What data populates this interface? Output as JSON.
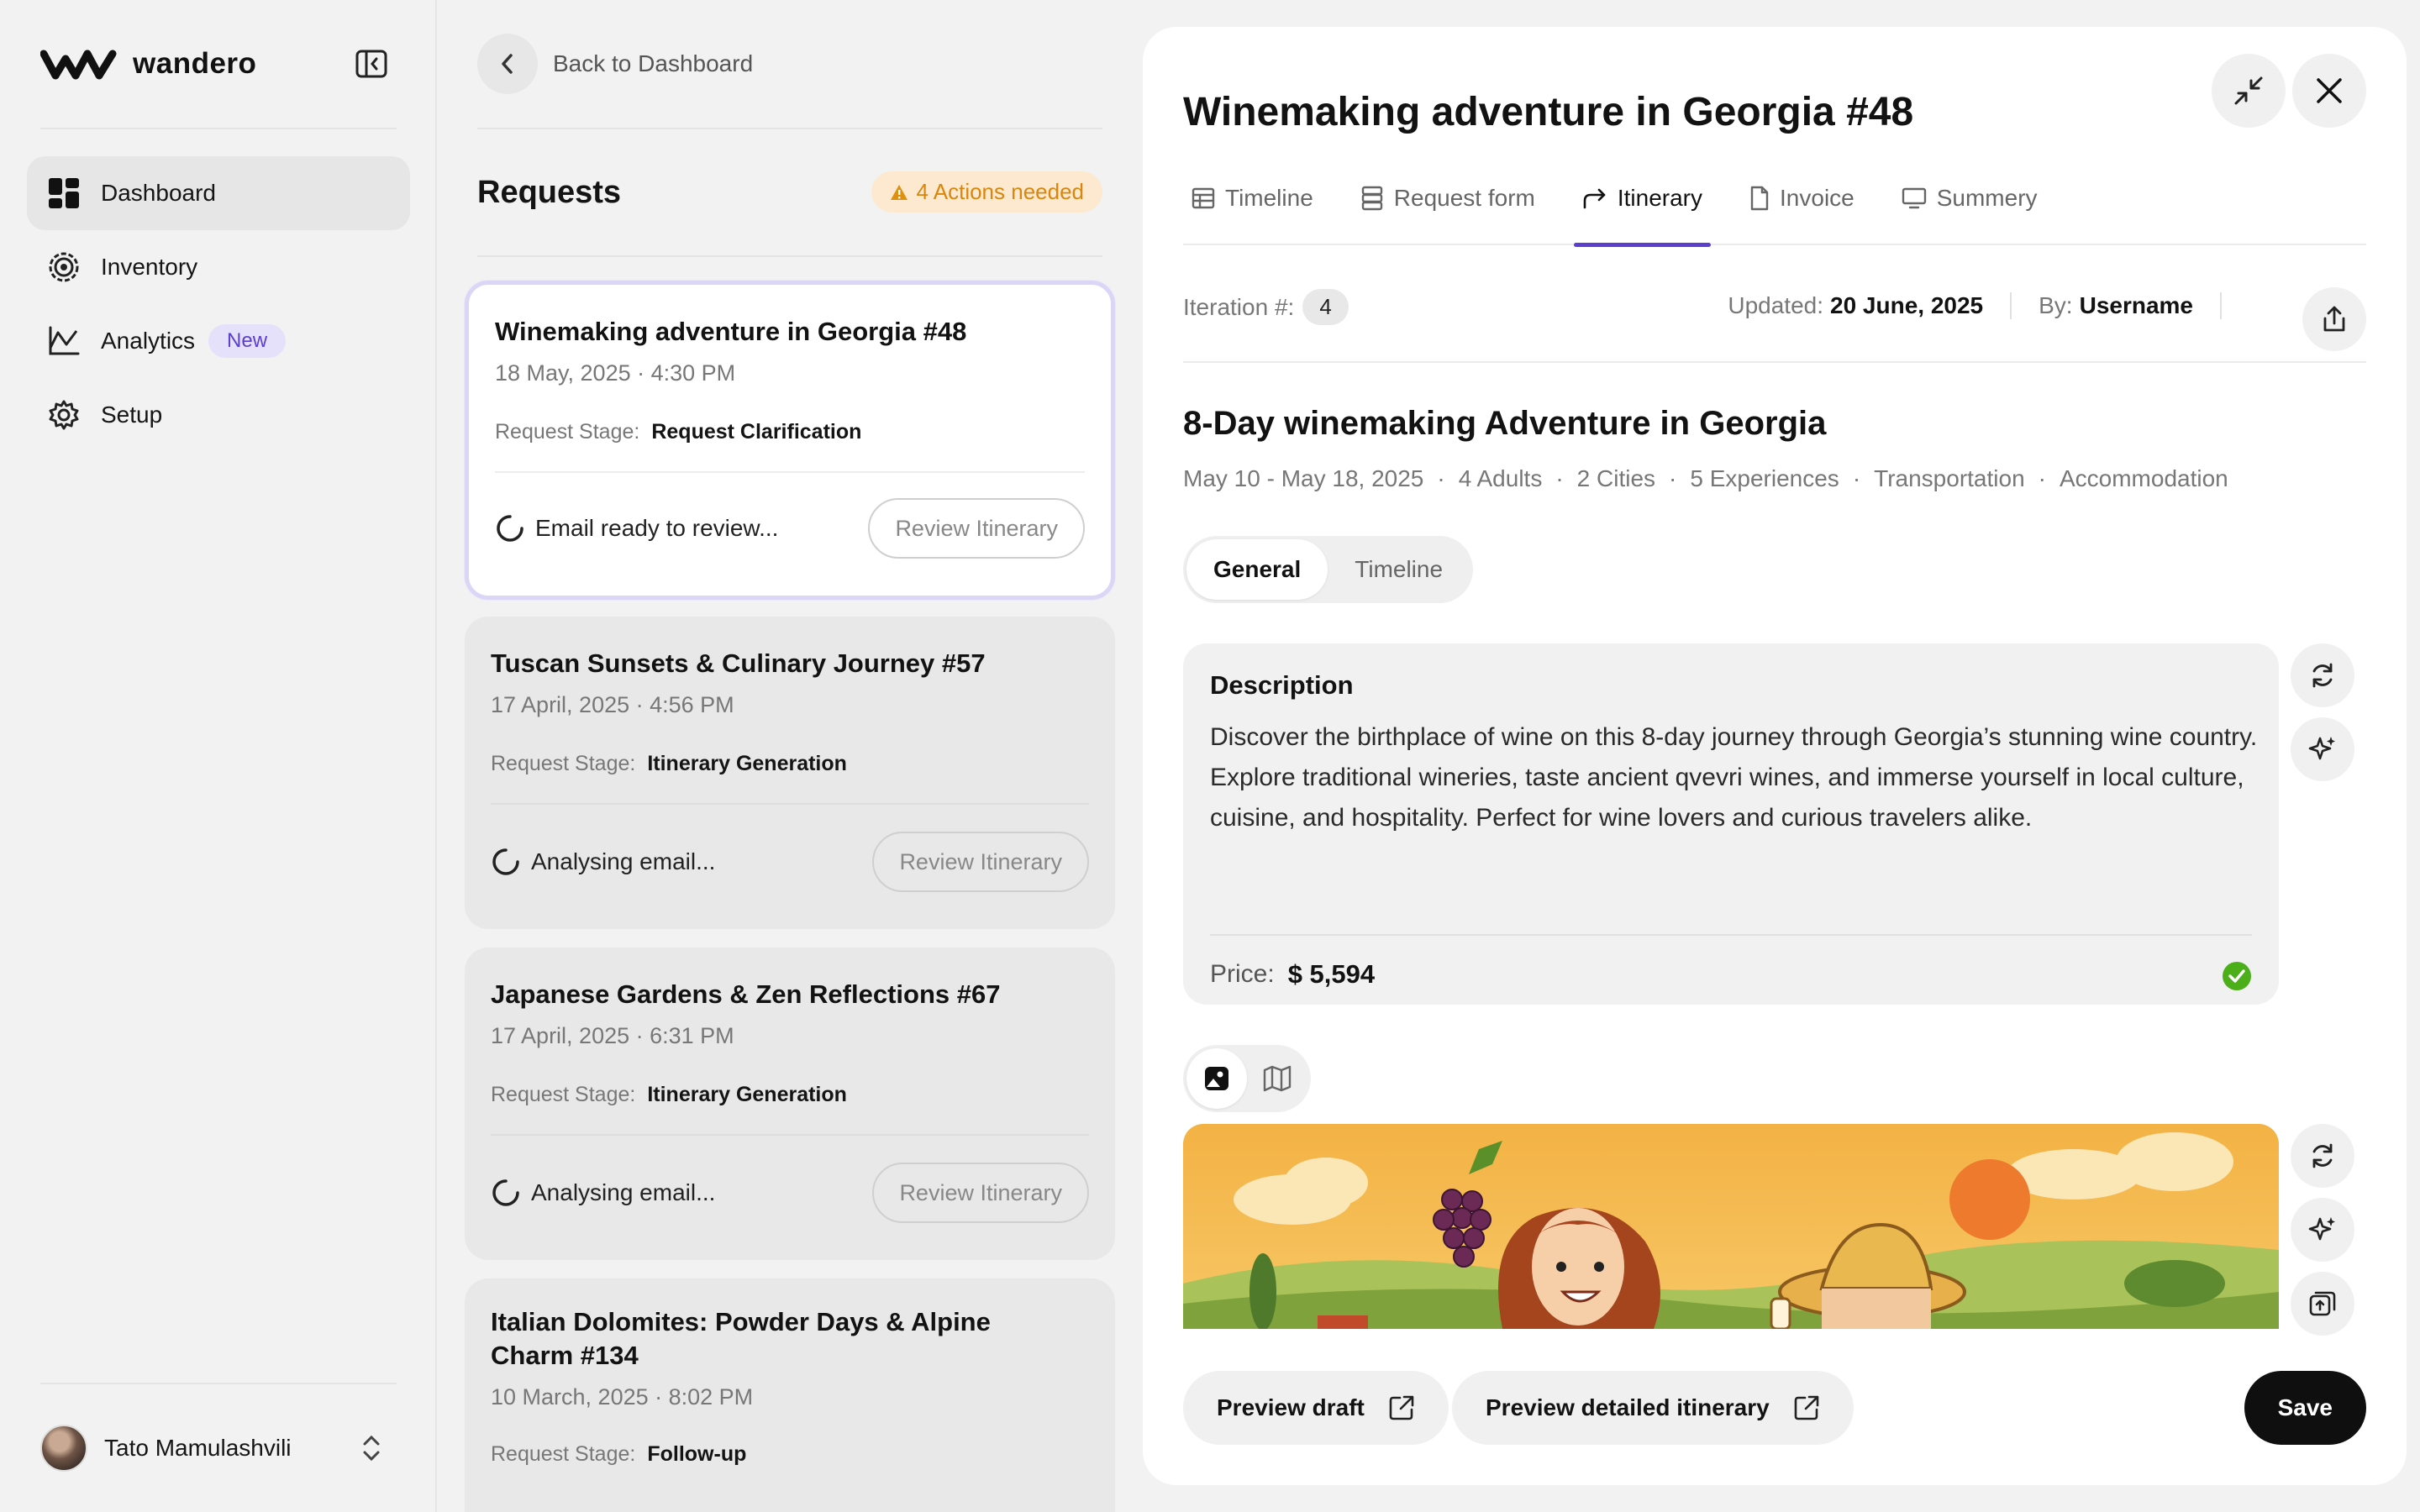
{
  "sidebar": {
    "brand": "wandero",
    "nav": [
      {
        "label": "Dashboard",
        "icon": "dashboard-icon"
      },
      {
        "label": "Inventory",
        "icon": "inventory-icon"
      },
      {
        "label": "Analytics",
        "icon": "analytics-icon",
        "badge": "New"
      },
      {
        "label": "Setup",
        "icon": "gear-icon"
      }
    ],
    "user": {
      "name": "Tato Mamulashvili"
    }
  },
  "requests": {
    "back_label": "Back to Dashboard",
    "title": "Requests",
    "actions_badge": "4 Actions needed",
    "stage_label": "Request Stage:",
    "review_label": "Review Itinerary",
    "items": [
      {
        "title": "Winemaking adventure in Georgia #48",
        "date": "18 May, 2025 · 4:30 PM",
        "stage": "Request Clarification",
        "status": "Email ready to review..."
      },
      {
        "title": "Tuscan Sunsets & Culinary Journey #57",
        "date": "17 April, 2025 · 4:56 PM",
        "stage": "Itinerary Generation",
        "status": "Analysing email..."
      },
      {
        "title": "Japanese Gardens & Zen Reflections #67",
        "date": "17 April, 2025 · 6:31 PM",
        "stage": "Itinerary Generation",
        "status": "Analysing email..."
      },
      {
        "title": "Italian Dolomites: Powder Days & Alpine Charm #134",
        "date": "10 March, 2025 · 8:02 PM",
        "stage": "Follow-up"
      }
    ]
  },
  "detail": {
    "title": "Winemaking adventure in Georgia #48",
    "tabs": [
      "Timeline",
      "Request form",
      "Itinerary",
      "Invoice",
      "Summery"
    ],
    "active_tab": "Itinerary",
    "iteration_label": "Iteration #:",
    "iteration": "4",
    "updated_label": "Updated:",
    "updated_value": "20 June, 2025",
    "by_label": "By:",
    "by_value": "Username",
    "trip_title": "8-Day winemaking Adventure in Georgia",
    "trip_meta": [
      "May 10 - May 18, 2025",
      "4 Adults",
      "2 Cities",
      "5 Experiences",
      "Transportation",
      "Accommodation"
    ],
    "segments": [
      "General",
      "Timeline"
    ],
    "description_label": "Description",
    "description": "Discover the birthplace of wine on this 8-day journey through Georgia’s stunning wine country. Explore traditional wineries, taste ancient qvevri wines, and immerse yourself in local culture, cuisine, and hospitality. Perfect for wine lovers and curious travelers alike.",
    "price_label": "Price:",
    "price": "$ 5,594",
    "footer": {
      "preview_draft": "Preview draft",
      "preview_detailed": "Preview detailed itinerary",
      "save": "Save"
    }
  },
  "colors": {
    "accent": "#5b3fcf",
    "warning": "#d9860d",
    "success": "#4caf1a"
  }
}
